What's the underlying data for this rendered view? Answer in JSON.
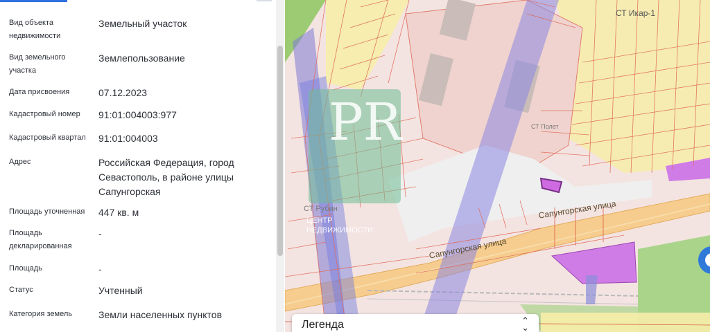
{
  "fields": [
    {
      "label": "Вид объекта недвижимости",
      "value": "Земельный участок"
    },
    {
      "label": "Вид земельного участка",
      "value": "Землепользование"
    },
    {
      "label": "Дата присвоения",
      "value": "07.12.2023"
    },
    {
      "label": "Кадастровый номер",
      "value": "91:01:004003:977"
    },
    {
      "label": "Кадастровый квартал",
      "value": "91:01:004003"
    },
    {
      "label": "Адрес",
      "value": "Российская Федерация, город Севастополь, в районе улицы Сапунгорская"
    },
    {
      "label": "Площадь уточненная",
      "value": "447 кв. м"
    },
    {
      "label": "Площадь декларированная",
      "value": "-"
    },
    {
      "label": "Площадь",
      "value": "-"
    },
    {
      "label": "Статус",
      "value": "Учтенный"
    },
    {
      "label": "Категория земель",
      "value": "Земли населенных пунктов"
    }
  ],
  "map": {
    "labels": {
      "street_1": "Сапунгорская улица",
      "street_2": "Сапунгорская улица",
      "st_ikar": "СТ Икар-1",
      "st_polet": "СТ Полет",
      "st_rubin": "СТ Рубин"
    },
    "watermark": {
      "letters": "PR",
      "text_line1": "ЦЕНТР",
      "text_line2": "НЕДВИЖИМОСТИ"
    },
    "legend": {
      "title": "Легенда",
      "toggle_icon": "chevron-up-down-icon"
    },
    "colors": {
      "parcel_border": "#e06a5a",
      "highlight_fill": "#cf6be0",
      "road": "#f3c27a",
      "corridor": "#7f7ad6"
    }
  }
}
